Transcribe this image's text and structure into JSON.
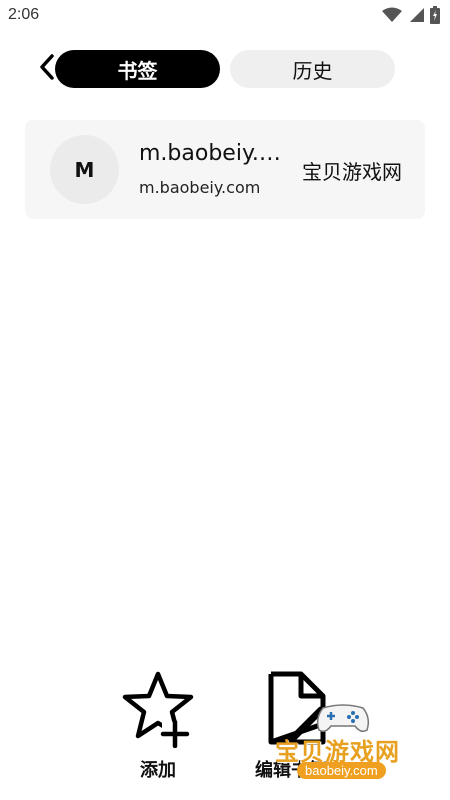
{
  "status_bar": {
    "time": "2:06",
    "icons": [
      "wifi-icon",
      "cell-signal-icon",
      "battery-icon"
    ]
  },
  "header": {
    "back_icon": "chevron-left-icon",
    "tabs": [
      {
        "label": "书签",
        "active": true
      },
      {
        "label": "历史",
        "active": false
      }
    ]
  },
  "bookmarks": [
    {
      "avatar_letter": "M",
      "title": "m.baobeiy.com",
      "url": "m.baobeiy.com",
      "label": "宝贝游戏网"
    }
  ],
  "actions": {
    "add_label": "添加",
    "add_icon": "star-plus-icon",
    "edit_label": "编辑书签",
    "edit_icon": "document-edit-icon"
  },
  "watermark": {
    "text": "宝贝游戏网",
    "domain": "baobeiy.com"
  },
  "colors": {
    "active_tab_bg": "#000000",
    "inactive_tab_bg": "#efefef",
    "card_bg": "#f6f6f6",
    "watermark_accent": "#e8a020"
  }
}
